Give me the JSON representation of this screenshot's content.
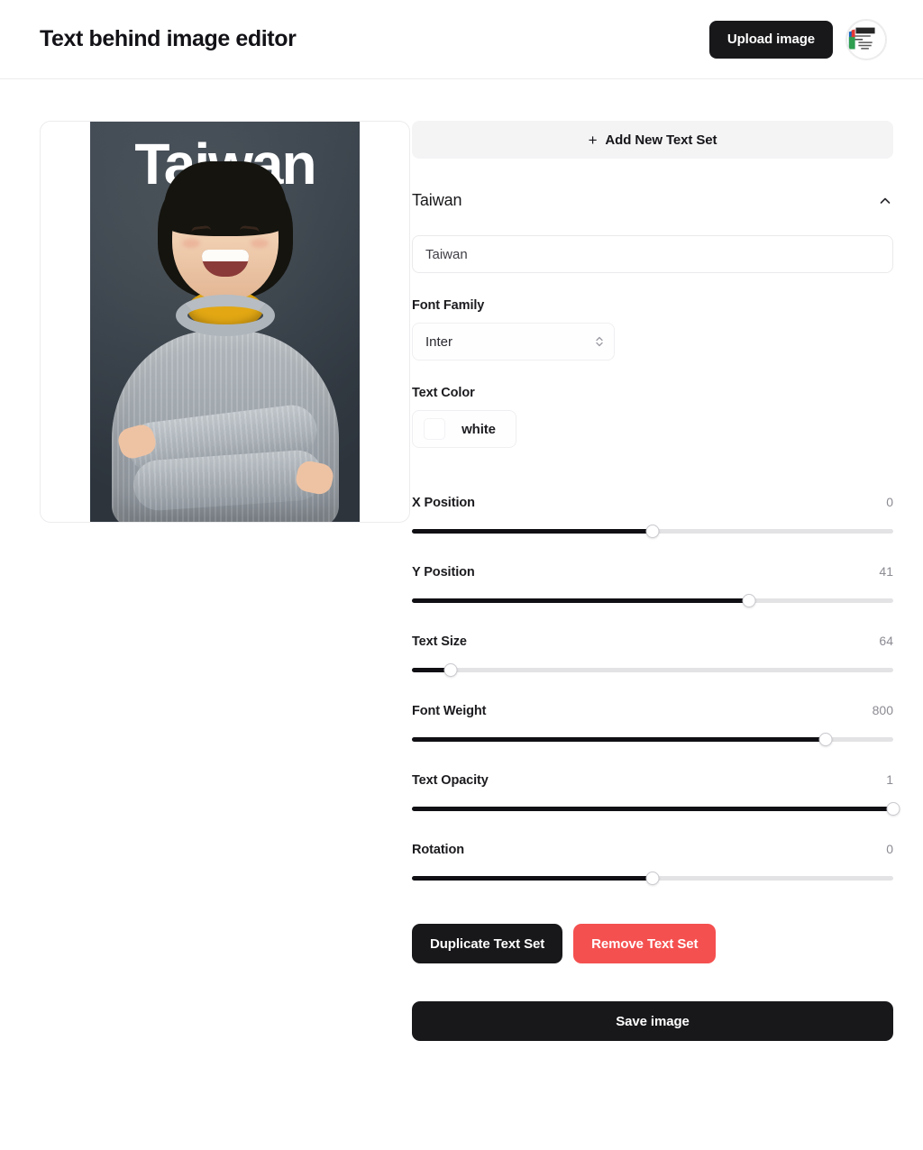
{
  "header": {
    "title": "Text behind image editor",
    "upload_label": "Upload image",
    "avatar_name": "user-avatar"
  },
  "preview": {
    "overlay_text": "Taiwan",
    "alt": "Smiling child with arms crossed wearing a grey knit sweater on a dark slate background"
  },
  "controls": {
    "add_textset_label": "Add New Text Set",
    "add_textset_icon": "plus-icon",
    "textset_title": "Taiwan",
    "collapse_icon": "chevron-up-icon",
    "text_value": "Taiwan",
    "text_placeholder": "Taiwan",
    "font_family_label": "Font Family",
    "font_family_value": "Inter",
    "font_family_options": [
      "Inter"
    ],
    "text_color_label": "Text Color",
    "text_color_value": "white",
    "text_color_hex": "#ffffff",
    "sliders": [
      {
        "label": "X Position",
        "value": "0",
        "percent": 50
      },
      {
        "label": "Y Position",
        "value": "41",
        "percent": 70
      },
      {
        "label": "Text Size",
        "value": "64",
        "percent": 8
      },
      {
        "label": "Font Weight",
        "value": "800",
        "percent": 86
      },
      {
        "label": "Text Opacity",
        "value": "1",
        "percent": 100
      },
      {
        "label": "Rotation",
        "value": "0",
        "percent": 50
      }
    ],
    "duplicate_label": "Duplicate Text Set",
    "remove_label": "Remove Text Set",
    "save_label": "Save image"
  },
  "colors": {
    "accent_dark": "#18181b",
    "danger": "#f4504f",
    "muted_bg": "#f4f4f5",
    "slider_fill": "#101014",
    "slider_rail": "#e3e3e5"
  }
}
